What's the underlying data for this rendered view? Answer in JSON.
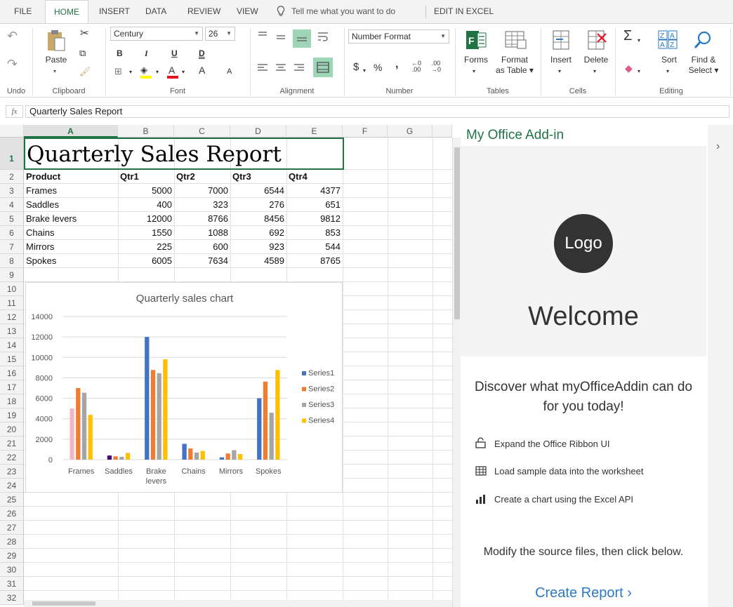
{
  "tabs": [
    "FILE",
    "HOME",
    "INSERT",
    "DATA",
    "REVIEW",
    "VIEW"
  ],
  "tell_me": "Tell me what you want to do",
  "edit_in_excel": "EDIT IN EXCEL",
  "ribbon": {
    "undo": "Undo",
    "paste": "Paste",
    "clipboard": "Clipboard",
    "font_name": "Century",
    "font_size": "26",
    "bold": "B",
    "italic": "I",
    "underline": "U",
    "double_underline": "D",
    "grow": "A",
    "shrink": "A",
    "font_color_letter": "A",
    "font": "Font",
    "alignment": "Alignment",
    "number_format": "Number Format",
    "dollar": "$",
    "percent": "%",
    "comma": ",",
    "inc_decimal": "←0\n.00",
    "dec_decimal": ".00\n→0",
    "number": "Number",
    "forms": "Forms",
    "format_as_table_1": "Format",
    "format_as_table_2": "as Table",
    "tables": "Tables",
    "insert": "Insert",
    "delete": "Delete",
    "cells": "Cells",
    "sum": "Σ",
    "sort": "Sort",
    "find_1": "Find &",
    "find_2": "Select",
    "editing": "Editing"
  },
  "formula_bar": {
    "fx": "fx",
    "value": "Quarterly Sales Report"
  },
  "columns": [
    "A",
    "B",
    "C",
    "D",
    "E",
    "F",
    "G"
  ],
  "rows": [
    "1",
    "2",
    "3",
    "4",
    "5",
    "6",
    "7",
    "8",
    "9",
    "10",
    "11",
    "12",
    "13",
    "14",
    "15",
    "16",
    "17",
    "18",
    "19",
    "20",
    "21",
    "22",
    "23",
    "24",
    "25",
    "26",
    "27",
    "28",
    "29",
    "30",
    "31",
    "32"
  ],
  "sheet": {
    "title": "Quarterly Sales Report",
    "headers": [
      "Product",
      "Qtr1",
      "Qtr2",
      "Qtr3",
      "Qtr4"
    ],
    "data": [
      [
        "Frames",
        "5000",
        "7000",
        "6544",
        "4377"
      ],
      [
        "Saddles",
        "400",
        "323",
        "276",
        "651"
      ],
      [
        "Brake levers",
        "12000",
        "8766",
        "8456",
        "9812"
      ],
      [
        "Chains",
        "1550",
        "1088",
        "692",
        "853"
      ],
      [
        "Mirrors",
        "225",
        "600",
        "923",
        "544"
      ],
      [
        "Spokes",
        "6005",
        "7634",
        "4589",
        "8765"
      ]
    ]
  },
  "chart_data": {
    "type": "bar",
    "title": "Quarterly sales chart",
    "categories": [
      "Frames",
      "Saddles",
      "Brake levers",
      "Chains",
      "Mirrors",
      "Spokes"
    ],
    "category_labels": [
      [
        "Frames"
      ],
      [
        "Saddles"
      ],
      [
        "Brake",
        "levers"
      ],
      [
        "Chains"
      ],
      [
        "Mirrors"
      ],
      [
        "Spokes"
      ]
    ],
    "series": [
      {
        "name": "Series1",
        "values": [
          5000,
          400,
          12000,
          1550,
          225,
          6005
        ],
        "color": "#4472c4"
      },
      {
        "name": "Series2",
        "values": [
          7000,
          323,
          8766,
          1088,
          600,
          7634
        ],
        "color": "#ed7d31"
      },
      {
        "name": "Series3",
        "values": [
          6544,
          276,
          8456,
          692,
          923,
          4589
        ],
        "color": "#a5a5a5"
      },
      {
        "name": "Series4",
        "values": [
          4377,
          651,
          9812,
          853,
          544,
          8765
        ],
        "color": "#ffc000"
      }
    ],
    "point_colors": {
      "0-0": "#f4b6c2",
      "0-1": "#4b0082"
    },
    "ylim": [
      0,
      14000
    ],
    "yticks": [
      "0",
      "2000",
      "4000",
      "6000",
      "8000",
      "10000",
      "12000",
      "14000"
    ],
    "grid": true,
    "legend": "right"
  },
  "addin": {
    "title": "My Office Add-in",
    "logo": "Logo",
    "welcome": "Welcome",
    "discover": "Discover what myOfficeAddin can do for you today!",
    "features": [
      "Expand the Office Ribbon UI",
      "Load sample data into the worksheet",
      "Create a chart using the Excel API"
    ],
    "modify": "Modify the source files, then click below.",
    "create": "Create Report"
  },
  "colors": {
    "accent": "#217346",
    "link": "#2b79c2"
  }
}
